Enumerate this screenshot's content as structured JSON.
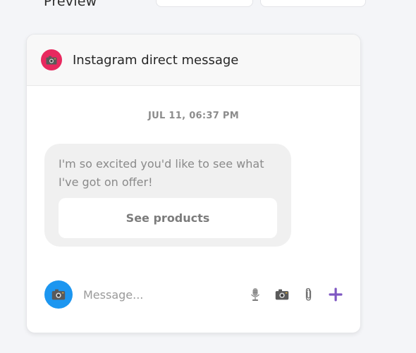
{
  "page": {
    "preview_label": "Preview"
  },
  "card": {
    "title": "Instagram direct message",
    "timestamp": "JUL 11, 06:37 PM",
    "message_text": "I'm so excited you'd like to see what I've got on offer!",
    "button_label": "See products"
  },
  "composer": {
    "placeholder": "Message...",
    "icons": [
      "microphone-icon",
      "camera-icon",
      "paperclip-icon",
      "plus-icon"
    ]
  },
  "colors": {
    "instagram_badge": "#e8295f",
    "camera_circle": "#1c96f0",
    "plus_accent": "#7e57c2"
  }
}
